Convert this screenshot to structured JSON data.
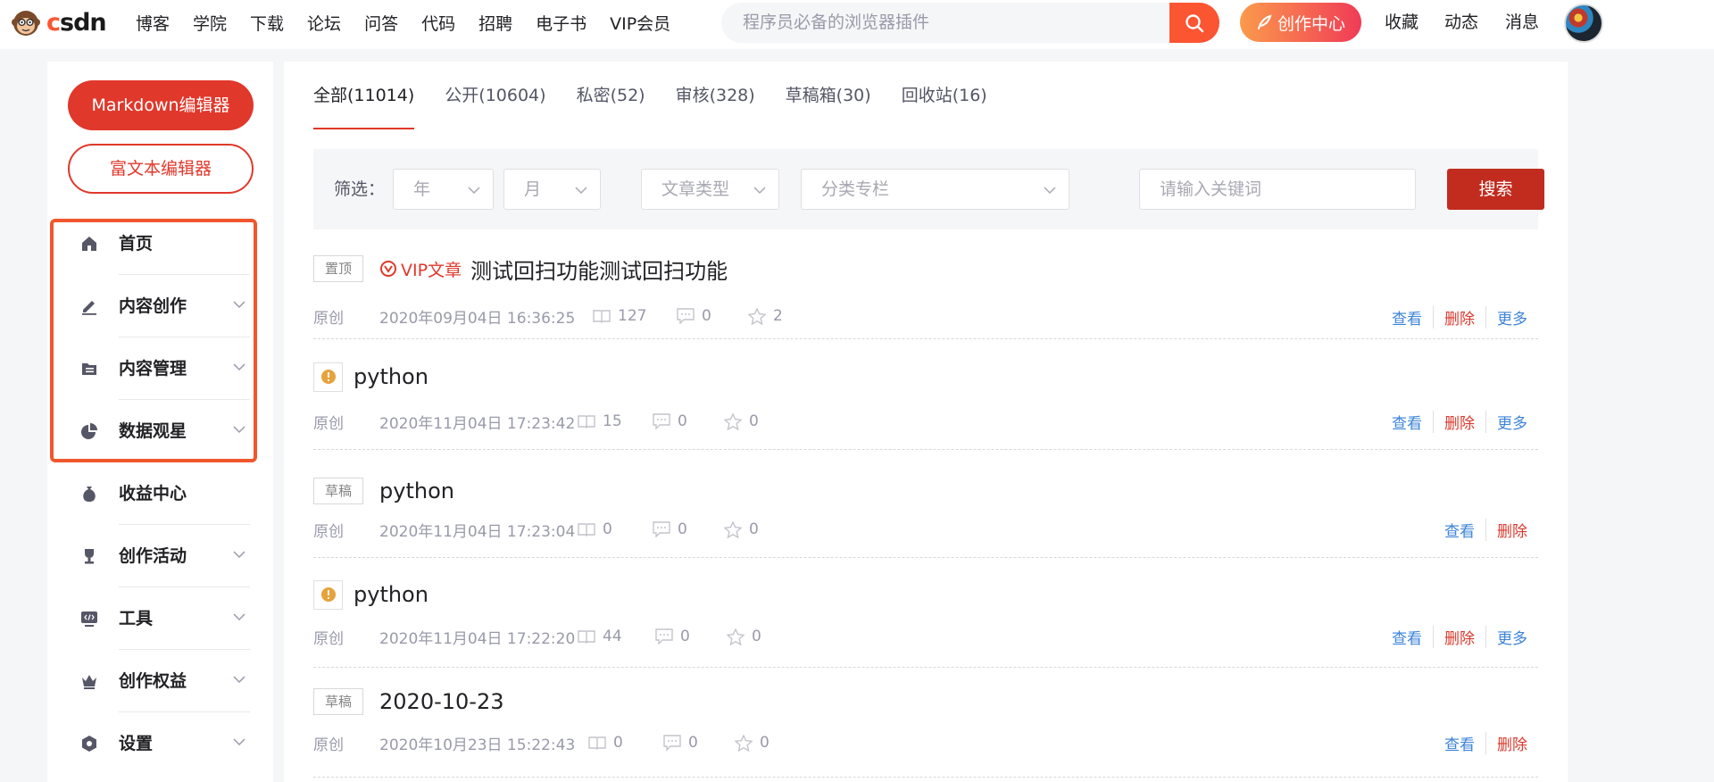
{
  "nav": {
    "items": [
      "博客",
      "学院",
      "下载",
      "论坛",
      "问答",
      "代码",
      "招聘",
      "电子书",
      "VIP会员"
    ],
    "search_placeholder": "程序员必备的浏览器插件",
    "create_center": "创作中心",
    "right": [
      "收藏",
      "动态",
      "消息"
    ]
  },
  "sidebar": {
    "markdown_editor": "Markdown编辑器",
    "richtext_editor": "富文本编辑器",
    "items": [
      {
        "label": "首页",
        "icon": "home-icon",
        "expandable": false
      },
      {
        "label": "内容创作",
        "icon": "pen-icon",
        "expandable": true
      },
      {
        "label": "内容管理",
        "icon": "folder-icon",
        "expandable": true
      },
      {
        "label": "数据观星",
        "icon": "pie-chart-icon",
        "expandable": true
      },
      {
        "label": "收益中心",
        "icon": "money-bag-icon",
        "expandable": false
      },
      {
        "label": "创作活动",
        "icon": "trophy-icon",
        "expandable": true
      },
      {
        "label": "工具",
        "icon": "code-screen-icon",
        "expandable": true
      },
      {
        "label": "创作权益",
        "icon": "crown-icon",
        "expandable": true
      },
      {
        "label": "设置",
        "icon": "settings-hex-icon",
        "expandable": true
      }
    ]
  },
  "tabs": [
    "全部(11014)",
    "公开(10604)",
    "私密(52)",
    "审核(328)",
    "草稿箱(30)",
    "回收站(16)"
  ],
  "filter": {
    "label": "筛选：",
    "year": "年",
    "month": "月",
    "article_type": "文章类型",
    "category": "分类专栏",
    "keyword_placeholder": "请输入关键词",
    "search_button": "搜索"
  },
  "articles": [
    {
      "tag": "置顶",
      "vip": "VIP文章",
      "title": "测试回扫功能测试回扫功能",
      "type": "原创",
      "date": "2020年09月04日 16:36:25",
      "views": "127",
      "comments": "0",
      "stars": "2",
      "actions": [
        "查看",
        "删除",
        "更多"
      ]
    },
    {
      "warn": true,
      "title": "python",
      "type": "原创",
      "date": "2020年11月04日 17:23:42",
      "views": "15",
      "comments": "0",
      "stars": "0",
      "actions": [
        "查看",
        "删除",
        "更多"
      ]
    },
    {
      "tag": "草稿",
      "title": "python",
      "type": "原创",
      "date": "2020年11月04日 17:23:04",
      "views": "0",
      "comments": "0",
      "stars": "0",
      "actions": [
        "查看",
        "删除"
      ]
    },
    {
      "warn": true,
      "title": "python",
      "type": "原创",
      "date": "2020年11月04日 17:22:20",
      "views": "44",
      "comments": "0",
      "stars": "0",
      "actions": [
        "查看",
        "删除",
        "更多"
      ]
    },
    {
      "tag": "草稿",
      "title": "2020-10-23",
      "type": "原创",
      "date": "2020年10月23日 15:22:43",
      "views": "0",
      "comments": "0",
      "stars": "0",
      "actions": [
        "查看",
        "删除"
      ]
    }
  ],
  "colors": {
    "brand": "#fc5531",
    "primary_red": "#e0382b",
    "link_blue": "#3d84d8",
    "highlight_border": "#f0572d"
  }
}
